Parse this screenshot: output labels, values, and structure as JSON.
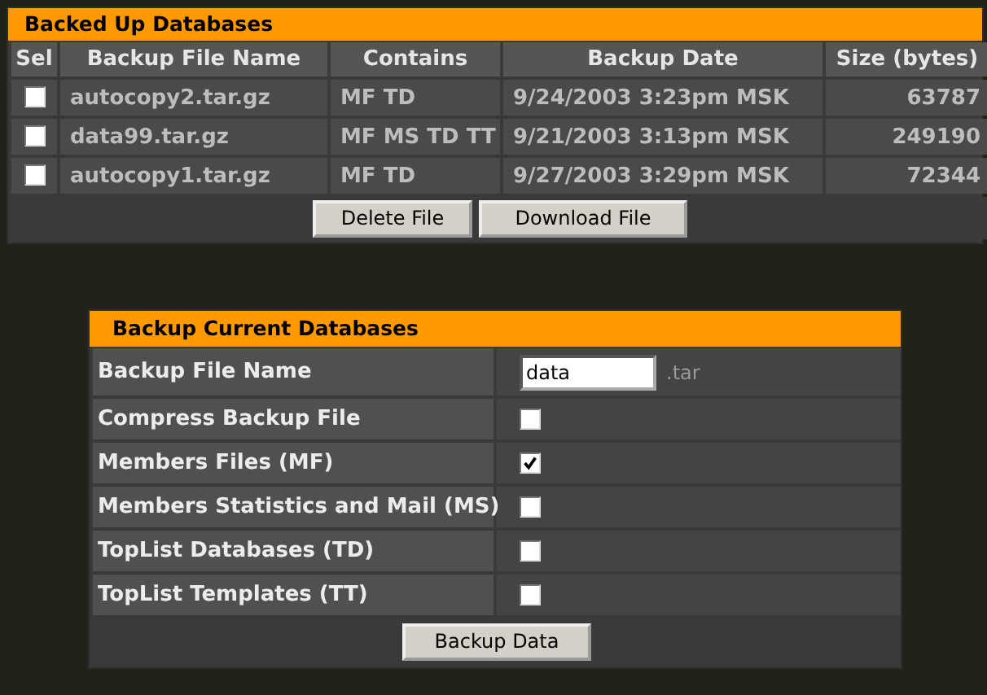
{
  "backed_up": {
    "title": "Backed Up Databases",
    "columns": [
      "Sel",
      "Backup File Name",
      "Contains",
      "Backup Date",
      "Size (bytes)"
    ],
    "rows": [
      {
        "selected": false,
        "file": "autocopy2.tar.gz",
        "contains": "MF TD",
        "date": "9/24/2003 3:23pm MSK",
        "size": "63787"
      },
      {
        "selected": false,
        "file": "data99.tar.gz",
        "contains": "MF MS TD TT",
        "date": "9/21/2003 3:13pm MSK",
        "size": "249190"
      },
      {
        "selected": false,
        "file": "autocopy1.tar.gz",
        "contains": "MF TD",
        "date": "9/27/2003 3:29pm MSK",
        "size": "72344"
      }
    ],
    "buttons": [
      "Delete File",
      "Download File"
    ]
  },
  "backup_current": {
    "title": "Backup Current Databases",
    "fields": [
      {
        "kind": "text",
        "label": "Backup File Name",
        "value": "data",
        "suffix": ".tar"
      },
      {
        "kind": "checkbox",
        "label": "Compress Backup File",
        "checked": false
      },
      {
        "kind": "checkbox",
        "label": "Members Files (MF)",
        "checked": true
      },
      {
        "kind": "checkbox",
        "label": "Members Statistics and Mail (MS)",
        "checked": false
      },
      {
        "kind": "checkbox",
        "label": "TopList Databases (TD)",
        "checked": false
      },
      {
        "kind": "checkbox",
        "label": "TopList Templates (TT)",
        "checked": false
      }
    ],
    "button": "Backup Data"
  }
}
